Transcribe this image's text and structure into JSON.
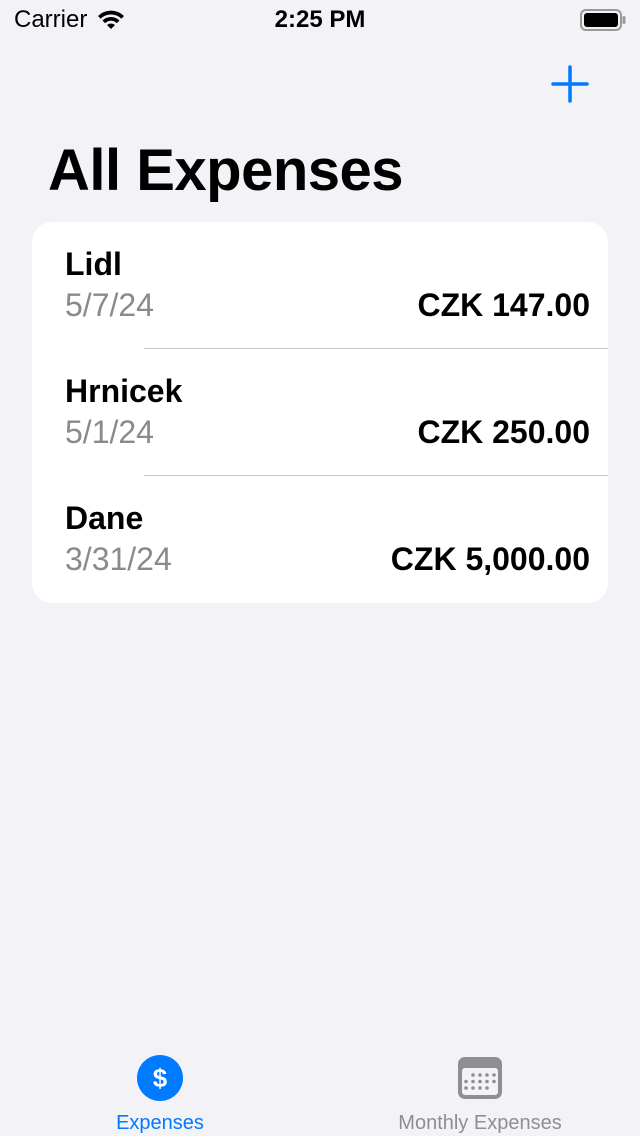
{
  "status_bar": {
    "carrier": "Carrier",
    "time": "2:25 PM"
  },
  "nav": {
    "add_icon": "plus-icon",
    "accent_color": "#007aff"
  },
  "page": {
    "title": "All Expenses"
  },
  "expenses": [
    {
      "name": "Lidl",
      "date": "5/7/24",
      "amount": "CZK 147.00"
    },
    {
      "name": "Hrnicek",
      "date": "5/1/24",
      "amount": "CZK 250.00"
    },
    {
      "name": "Dane",
      "date": "3/31/24",
      "amount": "CZK 5,000.00"
    }
  ],
  "tab_bar": {
    "tabs": [
      {
        "label": "Expenses",
        "icon": "dollar-sign-icon",
        "selected": true
      },
      {
        "label": "Monthly Expenses",
        "icon": "calendar-icon",
        "selected": false
      }
    ],
    "selected_color": "#007aff",
    "unselected_color": "#8e8e93"
  }
}
